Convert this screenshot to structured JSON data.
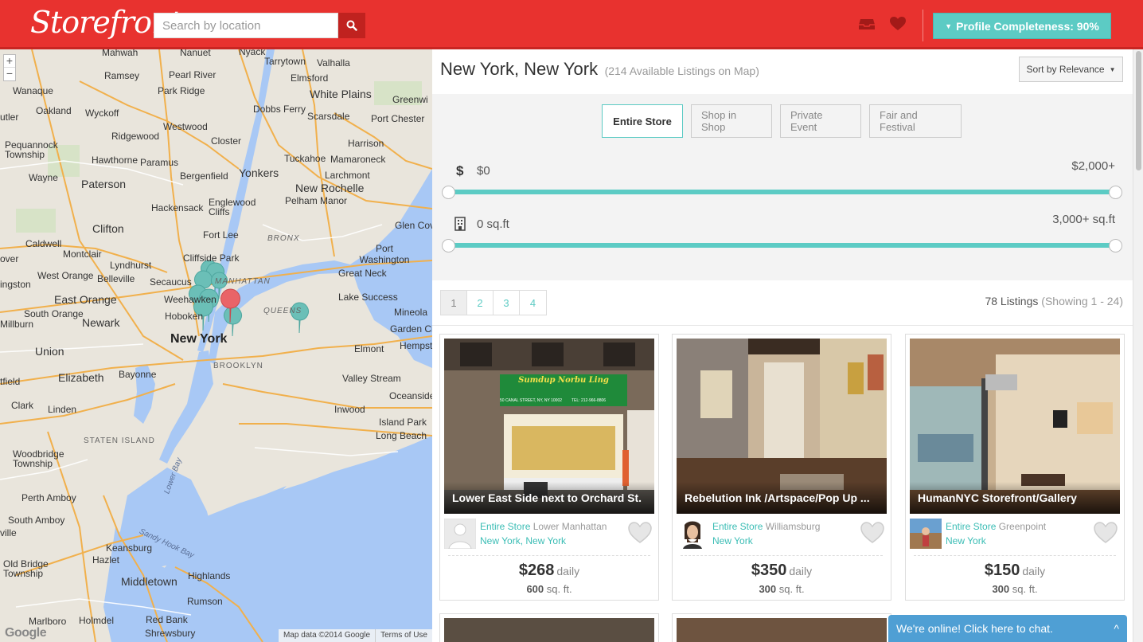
{
  "header": {
    "logo": "Storefront",
    "search_placeholder": "Search by location",
    "profile_label": "Profile Completeness: 90%"
  },
  "map": {
    "labels": [
      "Mahwah",
      "Nanuet",
      "Nyack",
      "Tarrytown",
      "Valhalla",
      "Ramsey",
      "Pearl River",
      "Elmsford",
      "White Plains",
      "Greenwi",
      "Wanaque",
      "Park Ridge",
      "Oakland",
      "Dobbs Ferry",
      "Wyckoff",
      "Scarsdale",
      "Port Chester",
      "Westwood",
      "Ridgewood",
      "Closter",
      "Harrison",
      "Pequannock Township",
      "Hawthorne",
      "Paramus",
      "Tuckahoe",
      "Mamaroneck",
      "Yonkers",
      "Bergenfield",
      "Larchmont",
      "Wayne",
      "Paterson",
      "New Rochelle",
      "Englewood Cliffs",
      "Pelham Manor",
      "Hackensack",
      "Glen Cov",
      "Clifton",
      "Fort Lee",
      "BRONX",
      "Caldwell",
      "Montclair",
      "Port Washington",
      "Lyndhurst",
      "Cliffside Park",
      "Great Neck",
      "West Orange",
      "Belleville",
      "Secaucus",
      "MANHATTAN",
      "Lake Success",
      "East Orange",
      "Weehawken",
      "QUEENS",
      "Mineola",
      "Newark",
      "Hoboken",
      "Garden Ci",
      "Union",
      "New York",
      "Elmont",
      "Hempst",
      "BROOKLYN",
      "Elizabeth",
      "Bayonne",
      "Valley Stream",
      "Oceanside",
      "Clark",
      "Linden",
      "Inwood",
      "Island Park",
      "Long Beach",
      "STATEN ISLAND",
      "Woodbridge Township",
      "Lower Bay",
      "Perth Amboy",
      "South Amboy",
      "Sandy Hook Bay",
      "Keansburg",
      "Old Bridge Township",
      "Hazlet",
      "Highlands",
      "Middletown",
      "Rumson",
      "Marlboro",
      "Holmdel",
      "Red Bank",
      "Shrewsbury",
      "Millburn",
      "South Orange",
      "ingston",
      "utler",
      "over",
      "tfield",
      "ville"
    ],
    "zoom_in": "+",
    "zoom_out": "−",
    "footer_data": "Map data ©2014 Google",
    "footer_terms": "Terms of Use",
    "google_mark": "Google"
  },
  "listing_header": {
    "city": "New York, New York",
    "map_count": "(214 Available Listings on Map)",
    "sort_label": "Sort by Relevance"
  },
  "filters": {
    "types": [
      "Entire Store",
      "Shop in Shop",
      "Private Event",
      "Fair and Festival"
    ],
    "price_min": "$0",
    "price_max": "$2,000+",
    "size_min": "0 sq.ft",
    "size_max": "3,000+ sq.ft",
    "price_range_fraction": [
      0.0,
      1.0
    ],
    "size_range_fraction": [
      0.0,
      1.0
    ]
  },
  "pagination": {
    "pages": [
      "1",
      "2",
      "3",
      "4"
    ],
    "total": "78 Listings",
    "showing": "(Showing 1 - 24)"
  },
  "listings": [
    {
      "title": "Lower East Side next to Orchard St.",
      "type": "Entire Store",
      "area": "Lower Manhattan",
      "location": "New York, New York",
      "price": "$268",
      "period": "daily",
      "size": "600",
      "size_unit": "sq. ft."
    },
    {
      "title": "Rebelution Ink /Artspace/Pop Up ...",
      "type": "Entire Store",
      "area": "Williamsburg",
      "location": "New York",
      "price": "$350",
      "period": "daily",
      "size": "300",
      "size_unit": "sq. ft."
    },
    {
      "title": "HumanNYC Storefront/Gallery",
      "type": "Entire Store",
      "area": "Greenpoint",
      "location": "New York",
      "price": "$150",
      "period": "daily",
      "size": "300",
      "size_unit": "sq. ft."
    }
  ],
  "storefront_sign": {
    "name": "Sumdup Norbu Ling",
    "address": "50 CANAL STREET, NY, NY 10002",
    "phone": "TEL: 212-966-8806"
  },
  "chat": {
    "label": "We're online! Click here to chat.",
    "toggle": "^"
  }
}
